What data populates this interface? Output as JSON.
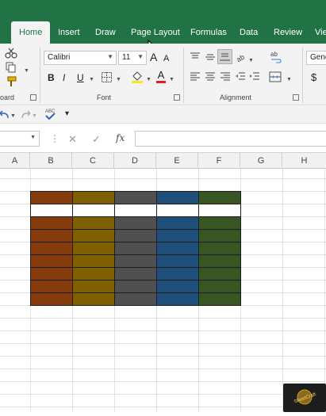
{
  "tabs": [
    "Home",
    "Insert",
    "Draw",
    "Page Layout",
    "Formulas",
    "Data",
    "Review",
    "View"
  ],
  "active_tab": "Home",
  "ribbon": {
    "clipboard_label": "oard",
    "font_label": "Font",
    "alignment_label": "Alignment",
    "font_name": "Calibri",
    "font_size": "11",
    "number_format": "Gene",
    "bold": "B",
    "italic": "I",
    "underline": "U",
    "increase_font": "A",
    "decrease_font": "A",
    "font_color_letter": "A",
    "currency": "$",
    "spelling": "ab"
  },
  "formula_bar": {
    "name_box": "",
    "fx_label": "fx",
    "formula": ""
  },
  "columns": [
    "A",
    "B",
    "C",
    "D",
    "E",
    "F",
    "G",
    "H"
  ],
  "table_colors": [
    "#843c0c",
    "#7f6000",
    "#505050",
    "#1f4e79",
    "#375623"
  ],
  "header_colors": {
    "white_row": "#ffffff",
    "border": "#1e1e1e"
  },
  "watermark_text": "SheetCraft"
}
